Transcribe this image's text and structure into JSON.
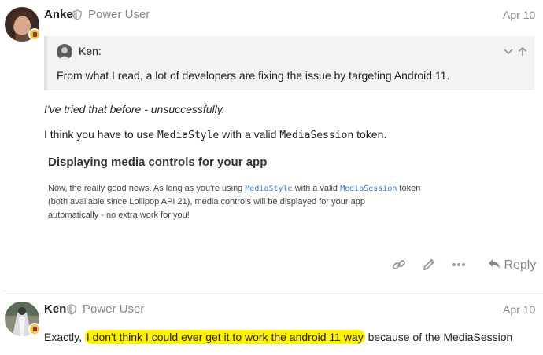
{
  "posts": [
    {
      "username": "Anke",
      "title": "Power User",
      "date": "Apr 10",
      "quote": {
        "author": "Ken:",
        "text": "From what I read, a lot of developers are fixing the issue by targeting Android 11."
      },
      "paragraph1": "I've tried that before - unsuccessfully.",
      "paragraph2": {
        "prefix": "I think you have to use ",
        "code1": "MediaStyle",
        "middle": " with a valid ",
        "code2": "MediaSession",
        "suffix": " token."
      },
      "onebox": {
        "title": "Displaying media controls for your app",
        "line1_prefix": "Now, the really good news. As long as you're using ",
        "line1_code1": "MediaStyle",
        "line1_middle": " with a valid ",
        "line1_code2": "MediaSession",
        "line1_suffix": " token",
        "line2": "(both available since Lollipop API 21), media controls will be displayed for your app",
        "line3": "automatically - no extra work for you!"
      },
      "actions": {
        "link_icon": "link-icon",
        "edit_icon": "pencil-icon",
        "more_icon": "ellipsis-icon",
        "reply_label": "Reply"
      }
    },
    {
      "username": "Ken",
      "title": "Power User",
      "date": "Apr 10",
      "body": {
        "prefix": "Exactly, ",
        "highlight": "I don't think I could ever get it to work the android 11 way",
        "suffix": " because of the MediaSession"
      }
    }
  ],
  "colors": {
    "highlight": "#fff200",
    "muted": "#888888",
    "code_link": "#3a7bd5"
  }
}
